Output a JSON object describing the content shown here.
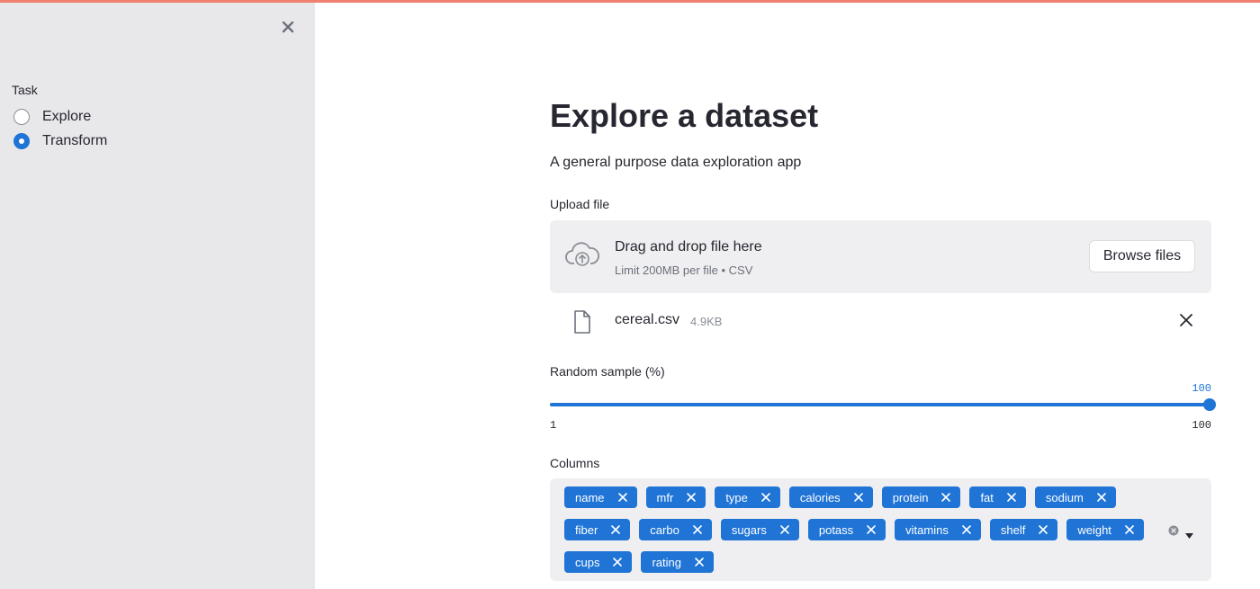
{
  "sidebar": {
    "task_label": "Task",
    "options": [
      {
        "label": "Explore",
        "checked": false
      },
      {
        "label": "Transform",
        "checked": true
      }
    ]
  },
  "main": {
    "title": "Explore a dataset",
    "subtitle": "A general purpose data exploration app"
  },
  "upload": {
    "label": "Upload file",
    "drag_text": "Drag and drop file here",
    "limit_text": "Limit 200MB per file • CSV",
    "browse_label": "Browse files",
    "file": {
      "name": "cereal.csv",
      "size": "4.9KB"
    }
  },
  "slider": {
    "label": "Random sample (%)",
    "value": "100",
    "min": "1",
    "max": "100",
    "fill_fraction": 1.0
  },
  "columns": {
    "label": "Columns",
    "tags": [
      "name",
      "mfr",
      "type",
      "calories",
      "protein",
      "fat",
      "sodium",
      "fiber",
      "carbo",
      "sugars",
      "potass",
      "vitamins",
      "shelf",
      "weight",
      "cups",
      "rating"
    ]
  },
  "colors": {
    "accent": "#1f74d6",
    "sidebar_bg": "#e8e8ea",
    "top_line": "#f08070"
  },
  "icons": {
    "sidebar_close": "close-icon",
    "upload": "cloud-upload-icon",
    "file": "file-icon",
    "file_remove": "close-icon",
    "tag_remove": "close-icon",
    "clear_all": "clear-circle-icon",
    "dropdown": "chevron-down-icon"
  }
}
